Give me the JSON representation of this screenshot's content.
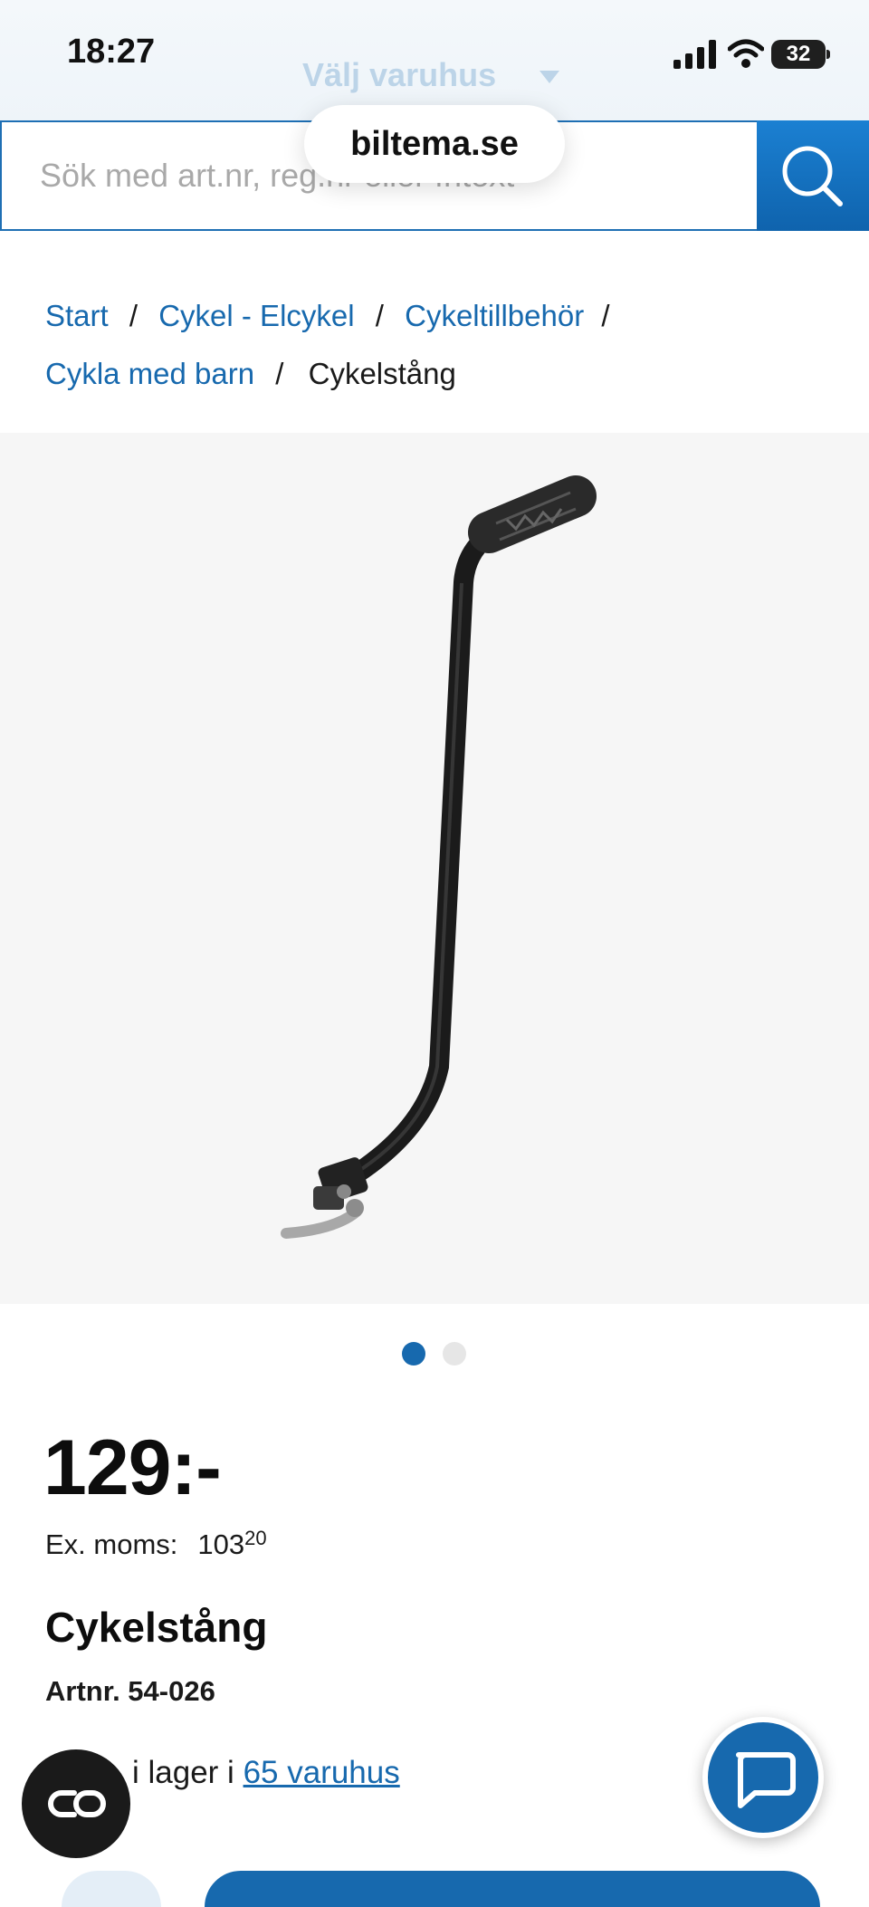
{
  "status_bar": {
    "time": "18:27",
    "battery": "32"
  },
  "header": {
    "store_selector_label": "Välj varuhus",
    "search_placeholder": "Sök med art.nr, reg.nr eller fritext",
    "url": "biltema.se"
  },
  "breadcrumb": {
    "items": [
      "Start",
      "Cykel - Elcykel",
      "Cykeltillbehör",
      "Cykla med barn"
    ],
    "separator": "/",
    "current": "Cykelstång"
  },
  "gallery": {
    "image_count": 2,
    "active_index": 0
  },
  "product": {
    "price": "129:-",
    "ex_moms_label": "Ex. moms:",
    "ex_moms_main": "103",
    "ex_moms_decimals": "20",
    "name": "Cykelstång",
    "artnr": "Artnr. 54-026",
    "stock_prefix": "i lager i",
    "stock_link": "65 varuhus"
  },
  "colors": {
    "brand_blue": "#1769ae",
    "image_bg": "#f6f6f6"
  },
  "icons": {
    "search": "search-icon",
    "chat": "chat-icon",
    "assistant": "assistant-icon"
  }
}
